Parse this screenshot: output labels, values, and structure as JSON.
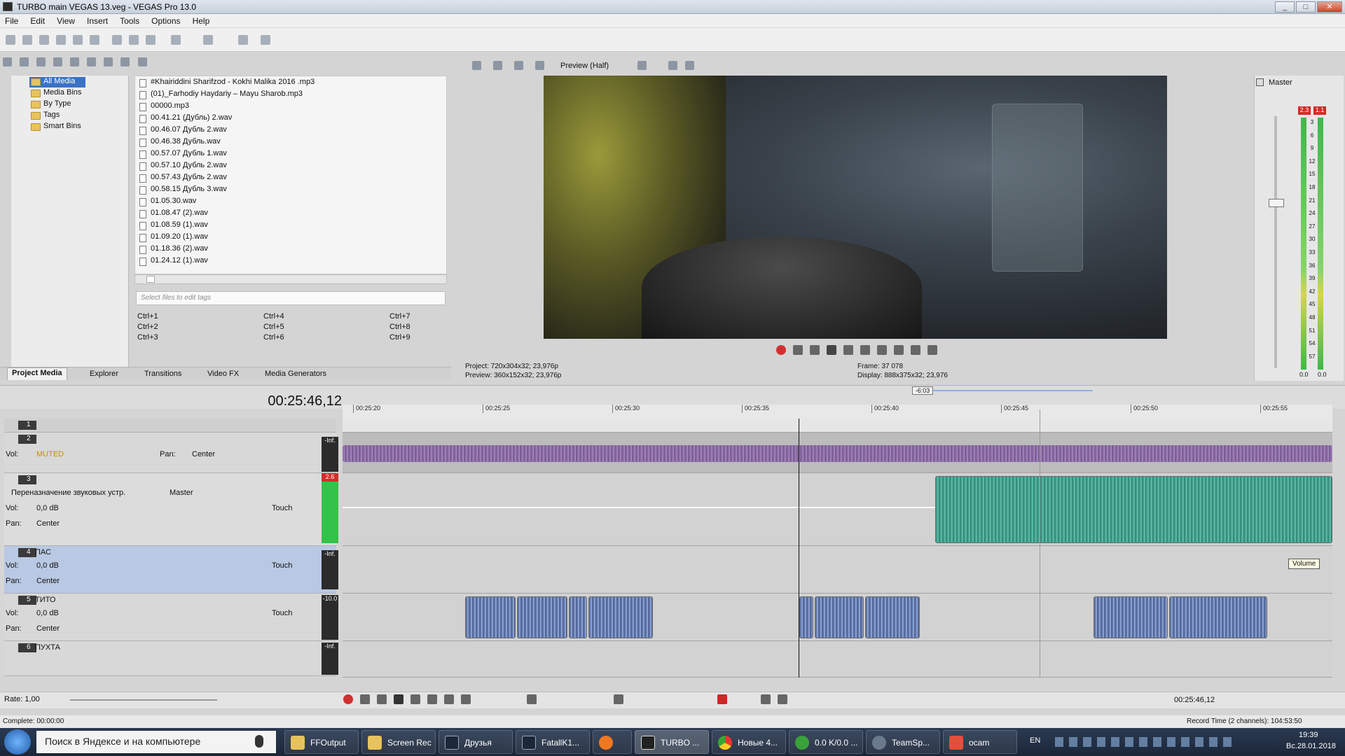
{
  "window": {
    "title": "TURBO main VEGAS 13.veg - VEGAS Pro 13.0"
  },
  "menu": [
    "File",
    "Edit",
    "View",
    "Insert",
    "Tools",
    "Options",
    "Help"
  ],
  "project_media": {
    "tree": [
      "All Media",
      "Media Bins",
      "By Type",
      "Tags",
      "Smart Bins"
    ],
    "files": [
      "#Khairiddini Sharifzod - Kokhi Malika 2016 .mp3",
      "(01)_Farhodiy Haydariy – Mayu Sharob.mp3",
      "00000.mp3",
      "00.41.21 (Дубль) 2.wav",
      "00.46.07 Дубль 2.wav",
      "00.46.38 Дубль.wav",
      "00.57.07 Дубль 1.wav",
      "00.57.10 Дубль 2.wav",
      "00.57.43 Дубль 2.wav",
      "00.58.15 Дубль 3.wav",
      "01.05.30.wav",
      "01.08.47 (2).wav",
      "01.08.59 (1).wav",
      "01.09.20 (1).wav",
      "01.18.36 (2).wav",
      "01.24.12 (1).wav"
    ],
    "tag_placeholder": "Select files to edit tags",
    "shortcuts": [
      [
        "Ctrl+1",
        "Ctrl+4",
        "Ctrl+7"
      ],
      [
        "Ctrl+2",
        "Ctrl+5",
        "Ctrl+8"
      ],
      [
        "Ctrl+3",
        "Ctrl+6",
        "Ctrl+9"
      ]
    ],
    "tabs": [
      "Project Media",
      "Explorer",
      "Transitions",
      "Video FX",
      "Media Generators"
    ]
  },
  "preview": {
    "mode": "Preview (Half)",
    "project": "Project:   720x304x32; 23,976p",
    "preview_info": "Preview:  360x152x32; 23,976p",
    "frame": "Frame:     37 078",
    "display": "Display:   888x375x32; 23,976"
  },
  "master": {
    "label": "Master",
    "peak_l": "2.3",
    "peak_r": "1.1",
    "scale": [
      "3",
      "6",
      "9",
      "12",
      "15",
      "18",
      "21",
      "24",
      "27",
      "30",
      "33",
      "36",
      "39",
      "42",
      "45",
      "48",
      "51",
      "54",
      "57"
    ],
    "bottom_l": "0.0",
    "bottom_r": "0.0"
  },
  "timeline": {
    "timecode": "00:25:46,12",
    "ruler": [
      "00:25:20",
      "00:25:25",
      "00:25:30",
      "00:25:35",
      "00:25:40",
      "00:25:45",
      "00:25:50",
      "00:25:55"
    ],
    "marker": "-6:03",
    "tracks": [
      {
        "num": "1",
        "name": ""
      },
      {
        "num": "2",
        "name": "",
        "vol_label": "Vol:",
        "vol_value": "MUTED",
        "pan_label": "Pan:",
        "pan_value": "Center",
        "peak": "-Inf."
      },
      {
        "num": "3",
        "name": "",
        "route": "Переназначение звуковых устр.",
        "route_target": "Master",
        "vol_label": "Vol:",
        "vol_value": "0,0 dB",
        "pan_label": "Pan:",
        "pan_value": "Center",
        "mode": "Touch",
        "peak": "2.6"
      },
      {
        "num": "4",
        "name": "ПАС",
        "vol_label": "Vol:",
        "vol_value": "0,0 dB",
        "pan_label": "Pan:",
        "pan_value": "Center",
        "mode": "Touch",
        "peak": "-Inf."
      },
      {
        "num": "5",
        "name": "ТИТО",
        "vol_label": "Vol:",
        "vol_value": "0,0 dB",
        "pan_label": "Pan:",
        "pan_value": "Center",
        "mode": "Touch",
        "peak": "-10.0"
      },
      {
        "num": "6",
        "name": "ПУХТА",
        "peak": "-Inf."
      }
    ],
    "tooltip": "Volume",
    "rate": "Rate: 1,00",
    "cursor_time": "00:25:46,12"
  },
  "status": {
    "complete": "Complete: 00:00:00",
    "record": "Record Time (2 channels): 104:53:50"
  },
  "taskbar": {
    "search": "Поиск в Яндексе и на компьютере",
    "items": [
      "FFOutput",
      "Screen Rec",
      "Друзья",
      "FatallK1...",
      "",
      "TURBO ...",
      "Новые 4...",
      "0.0 K/0.0 ...",
      "TeamSp...",
      "ocam"
    ],
    "lang": "EN",
    "time": "19:39",
    "date": "Вс.28.01.2018"
  },
  "colors": {
    "accent": "#3a72c4",
    "teal_clip": "#3f9c8a",
    "blue_clip": "#5d73a8",
    "purple_clip": "#8a60a8"
  }
}
